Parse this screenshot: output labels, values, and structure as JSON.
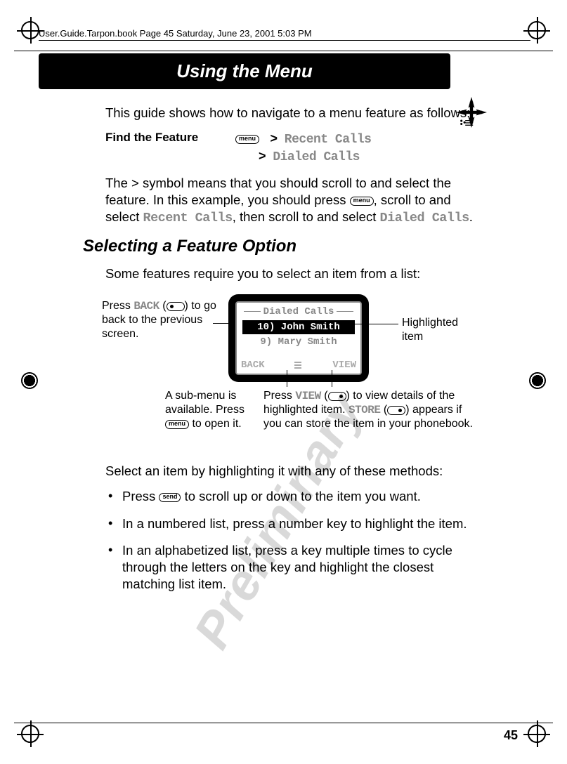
{
  "header": "User.Guide.Tarpon.book  Page 45  Saturday, June 23, 2001  5:03 PM",
  "title": "Using the Menu",
  "watermark": "Preliminary",
  "intro": "This guide shows how to navigate to a menu feature as follows:",
  "find_label": "Find the Feature",
  "find_key": "menu",
  "path1": "Recent Calls",
  "path2": "Dialed Calls",
  "explain_1": "The > symbol means that you should scroll to and select the feature. In this example, you should press ",
  "explain_1b": ", scroll to and select ",
  "explain_1c": "Recent Calls",
  "explain_1d": ", then scroll to and select ",
  "explain_1e": "Dialed Calls",
  "section": "Selecting a Feature Option",
  "section_intro": "Some features require you to select an item from a list:",
  "callout_back_1": "Press ",
  "callout_back_key": "BACK",
  "callout_back_2": " (",
  "callout_back_3": ") to go back to the previous screen.",
  "callout_hl": "Highlighted item",
  "callout_submenu_1": "A sub-menu is available. Press ",
  "callout_submenu_2": " to open it.",
  "callout_view_1": "Press ",
  "callout_view_key": "VIEW",
  "callout_view_2": " (",
  "callout_view_3": ") to view details of the highlighted item. ",
  "callout_view_store": "STORE",
  "callout_view_4": " (",
  "callout_view_5": ") appears if you can store the item in your phonebook.",
  "screen": {
    "title": "Dialed Calls",
    "row1": "10) John Smith",
    "row2": "9) Mary Smith",
    "soft_left": "BACK",
    "soft_right": "VIEW"
  },
  "after_diagram": "Select an item by highlighting it with any of these methods:",
  "bullets": {
    "b1a": "Press ",
    "b1b": " to scroll up or down to the item you want.",
    "b2": "In a numbered list, press a number key to highlight the item.",
    "b3": "In an alphabetized list, press a key multiple times to cycle through the letters on the key and highlight the closest matching list item."
  },
  "page_number": "45",
  "send_key": "send"
}
